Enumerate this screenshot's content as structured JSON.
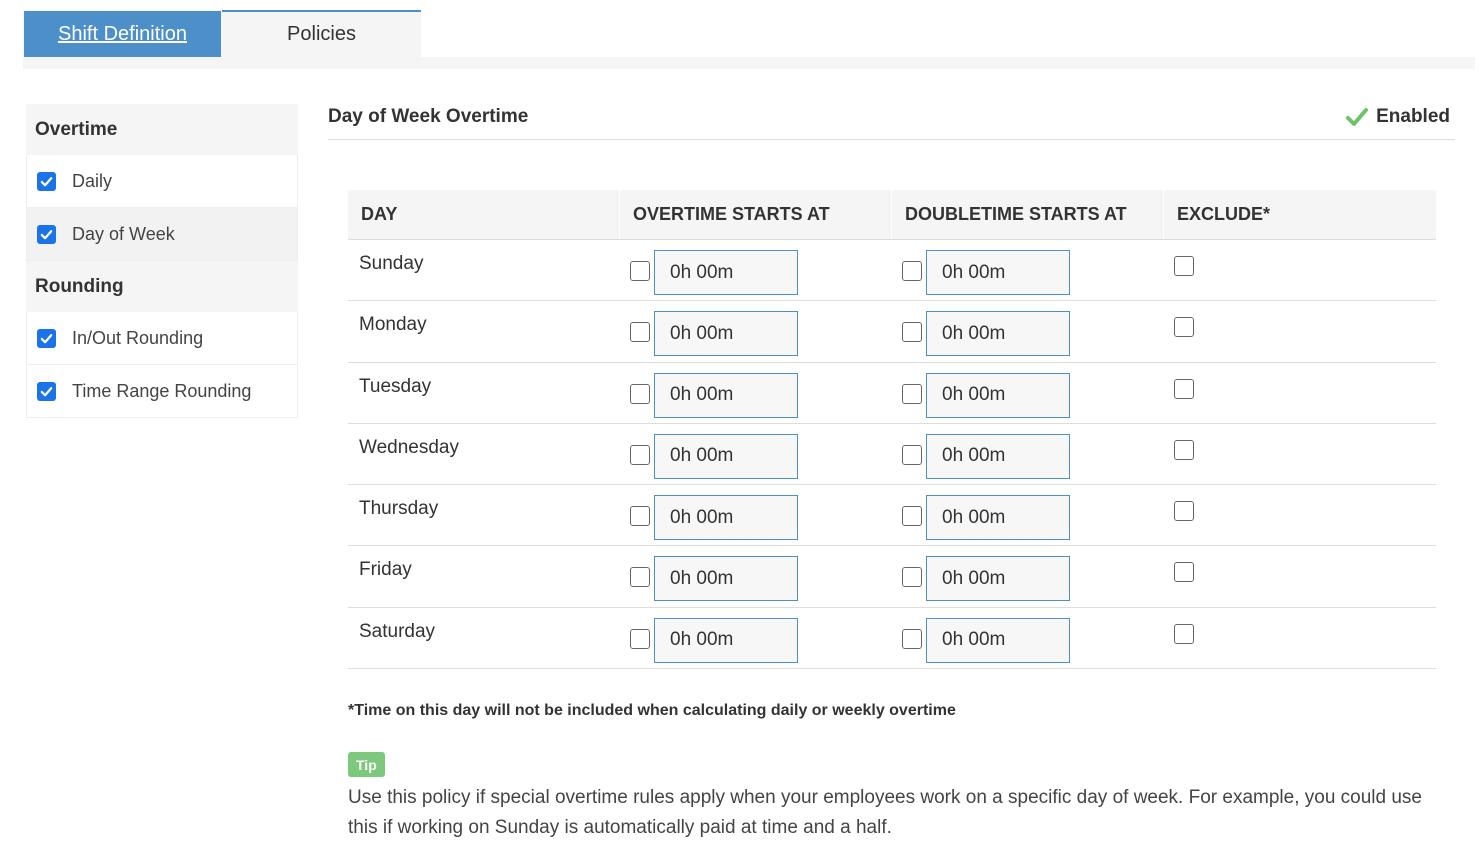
{
  "tabs": [
    {
      "label": "Shift Definition"
    },
    {
      "label": "Policies"
    }
  ],
  "sidebar": {
    "sections": [
      {
        "title": "Overtime",
        "items": [
          {
            "label": "Daily",
            "checked": true
          },
          {
            "label": "Day of Week",
            "checked": true
          }
        ]
      },
      {
        "title": "Rounding",
        "items": [
          {
            "label": "In/Out Rounding",
            "checked": true
          },
          {
            "label": "Time Range Rounding",
            "checked": true
          }
        ]
      }
    ]
  },
  "panel": {
    "title": "Day of Week Overtime",
    "status": "Enabled"
  },
  "table": {
    "headers": [
      "DAY",
      "OVERTIME STARTS AT",
      "DOUBLETIME STARTS AT",
      "EXCLUDE*"
    ],
    "rows": [
      {
        "day": "Sunday",
        "overtime": "0h 00m",
        "doubletime": "0h 00m"
      },
      {
        "day": "Monday",
        "overtime": "0h 00m",
        "doubletime": "0h 00m"
      },
      {
        "day": "Tuesday",
        "overtime": "0h 00m",
        "doubletime": "0h 00m"
      },
      {
        "day": "Wednesday",
        "overtime": "0h 00m",
        "doubletime": "0h 00m"
      },
      {
        "day": "Thursday",
        "overtime": "0h 00m",
        "doubletime": "0h 00m"
      },
      {
        "day": "Friday",
        "overtime": "0h 00m",
        "doubletime": "0h 00m"
      },
      {
        "day": "Saturday",
        "overtime": "0h 00m",
        "doubletime": "0h 00m"
      }
    ]
  },
  "footnote": "*Time on this day will not be included when calculating daily or weekly overtime",
  "tip": {
    "badge": "Tip",
    "text": "Use this policy if special overtime rules apply when your employees work on a specific day of week. For example, you could use this if working on Sunday is automatically paid at time and a half."
  },
  "colors": {
    "accent": "#4d8fc9",
    "checkbox": "#1a73e8",
    "enabled_check": "#6cc36c",
    "tip": "#7ec87e"
  }
}
